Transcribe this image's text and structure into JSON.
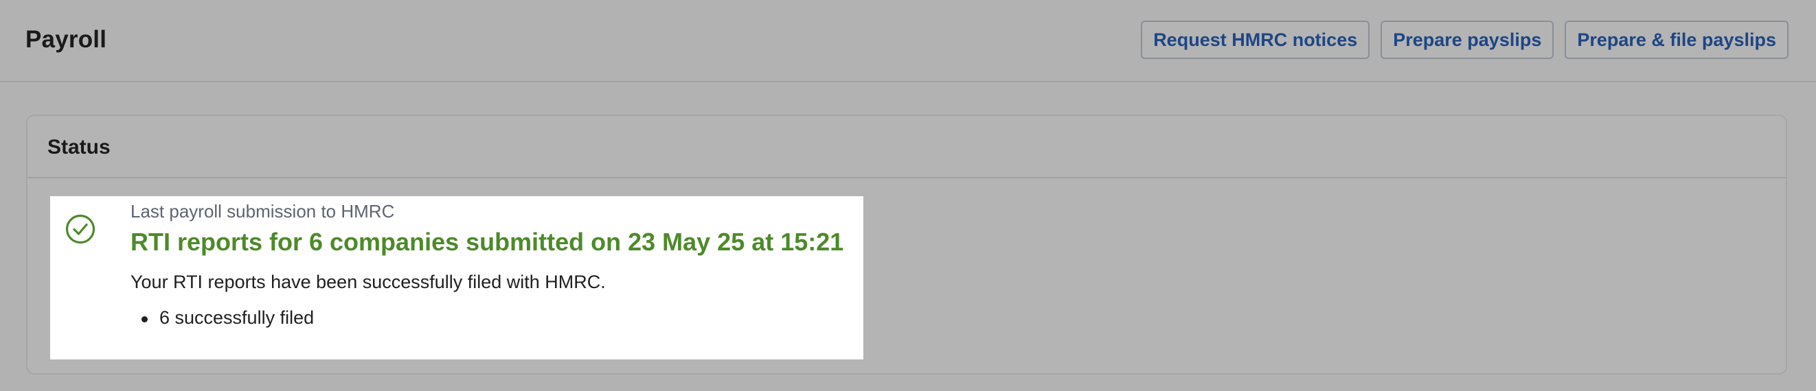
{
  "header": {
    "title": "Payroll",
    "buttons": [
      {
        "label": "Request HMRC notices"
      },
      {
        "label": "Prepare payslips"
      },
      {
        "label": "Prepare & file payslips"
      }
    ]
  },
  "status_panel": {
    "title": "Status",
    "card": {
      "icon": "check-circle-icon",
      "subtitle": "Last payroll submission to HMRC",
      "headline": "RTI reports for 6 companies submitted on 23 May 25 at 15:21",
      "description": "Your RTI reports have been successfully filed with HMRC.",
      "items": [
        "6 successfully filed"
      ]
    }
  },
  "colors": {
    "success": "#4d8a2a",
    "link": "#1d4685",
    "subtle_text": "#5d6470"
  }
}
